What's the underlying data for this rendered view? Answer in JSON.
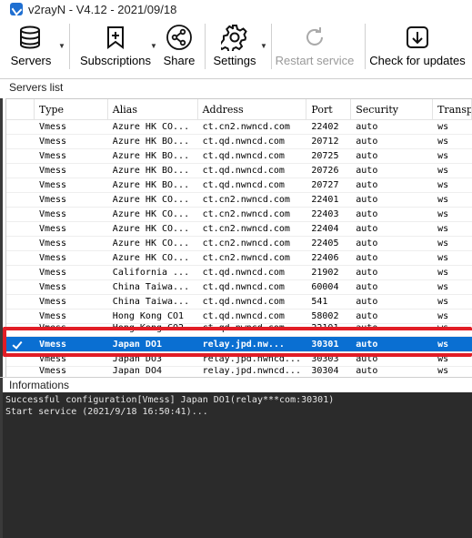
{
  "window": {
    "title": "v2rayN - V4.12 - 2021/09/18",
    "app_icon": "v2rayn-logo-icon"
  },
  "toolbar": {
    "items": [
      {
        "label": "Servers",
        "icon": "database-icon",
        "has_dropdown": true,
        "enabled": true
      },
      {
        "label": "Subscriptions",
        "icon": "bookmark-add-icon",
        "has_dropdown": true,
        "enabled": true
      },
      {
        "label": "Share",
        "icon": "share-icon",
        "has_dropdown": false,
        "enabled": true
      },
      {
        "label": "Settings",
        "icon": "gear-icon",
        "has_dropdown": true,
        "enabled": true
      },
      {
        "label": "Restart service",
        "icon": "refresh-icon",
        "has_dropdown": false,
        "enabled": false
      },
      {
        "label": "Check for updates",
        "icon": "download-icon",
        "has_dropdown": false,
        "enabled": true
      }
    ]
  },
  "servers": {
    "section_label": "Servers list",
    "columns": [
      "",
      "Type",
      "Alias",
      "Address",
      "Port",
      "Security",
      "Transp"
    ],
    "rows": [
      {
        "type": "Vmess",
        "alias": "Azure HK CO...",
        "address": "ct.cn2.nwncd.com",
        "port": "22402",
        "security": "auto",
        "transport": "ws"
      },
      {
        "type": "Vmess",
        "alias": "Azure HK BO...",
        "address": "ct.qd.nwncd.com",
        "port": "20712",
        "security": "auto",
        "transport": "ws"
      },
      {
        "type": "Vmess",
        "alias": "Azure HK BO...",
        "address": "ct.qd.nwncd.com",
        "port": "20725",
        "security": "auto",
        "transport": "ws"
      },
      {
        "type": "Vmess",
        "alias": "Azure HK BO...",
        "address": "ct.qd.nwncd.com",
        "port": "20726",
        "security": "auto",
        "transport": "ws"
      },
      {
        "type": "Vmess",
        "alias": "Azure HK BO...",
        "address": "ct.qd.nwncd.com",
        "port": "20727",
        "security": "auto",
        "transport": "ws"
      },
      {
        "type": "Vmess",
        "alias": "Azure HK CO...",
        "address": "ct.cn2.nwncd.com",
        "port": "22401",
        "security": "auto",
        "transport": "ws"
      },
      {
        "type": "Vmess",
        "alias": "Azure HK CO...",
        "address": "ct.cn2.nwncd.com",
        "port": "22403",
        "security": "auto",
        "transport": "ws"
      },
      {
        "type": "Vmess",
        "alias": "Azure HK CO...",
        "address": "ct.cn2.nwncd.com",
        "port": "22404",
        "security": "auto",
        "transport": "ws"
      },
      {
        "type": "Vmess",
        "alias": "Azure HK CO...",
        "address": "ct.cn2.nwncd.com",
        "port": "22405",
        "security": "auto",
        "transport": "ws"
      },
      {
        "type": "Vmess",
        "alias": "Azure HK CO...",
        "address": "ct.cn2.nwncd.com",
        "port": "22406",
        "security": "auto",
        "transport": "ws"
      },
      {
        "type": "Vmess",
        "alias": "California ...",
        "address": "ct.qd.nwncd.com",
        "port": "21902",
        "security": "auto",
        "transport": "ws"
      },
      {
        "type": "Vmess",
        "alias": "China Taiwa...",
        "address": "ct.qd.nwncd.com",
        "port": "60004",
        "security": "auto",
        "transport": "ws"
      },
      {
        "type": "Vmess",
        "alias": "China Taiwa...",
        "address": "ct.qd.nwncd.com",
        "port": "541",
        "security": "auto",
        "transport": "ws"
      },
      {
        "type": "Vmess",
        "alias": "Hong Kong CO1",
        "address": "ct.qd.nwncd.com",
        "port": "58002",
        "security": "auto",
        "transport": "ws"
      },
      {
        "type": "Vmess",
        "alias": "Hong Kong CO2",
        "address": "ct.qd.nwncd.com",
        "port": "22101",
        "security": "auto",
        "transport": "ws"
      }
    ],
    "selected_row": {
      "type": "Vmess",
      "alias": "Japan DO1",
      "address": "relay.jpd.nw...",
      "port": "30301",
      "security": "auto",
      "transport": "ws"
    },
    "after_rows": [
      {
        "type": "Vmess",
        "alias": "Japan DO3",
        "address": "relay.jpd.nwncd...",
        "port": "30303",
        "security": "auto",
        "transport": "ws"
      },
      {
        "type": "Vmess",
        "alias": "Japan DO4",
        "address": "relay.jpd.nwncd...",
        "port": "30304",
        "security": "auto",
        "transport": "ws"
      }
    ]
  },
  "informations": {
    "section_label": "Informations",
    "log_lines": [
      "Successful configuration[Vmess] Japan DO1(relay***com:30301)",
      "Start service (2021/9/18 16:50:41)..."
    ]
  },
  "colors": {
    "selection": "#0a6fd2",
    "highlight": "#e11d26",
    "log_bg": "#2b2b2b"
  }
}
